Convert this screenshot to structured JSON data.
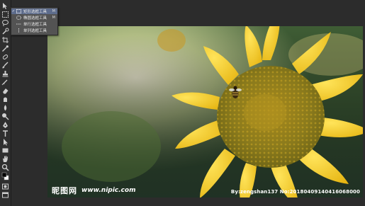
{
  "tool_flyout": {
    "items": [
      {
        "label": "矩形选框工具",
        "shortcut": "M",
        "selected": true,
        "icon": "rect-marquee-icon"
      },
      {
        "label": "椭圆选框工具",
        "shortcut": "M",
        "selected": false,
        "icon": "ellipse-marquee-icon"
      },
      {
        "label": "单行选框工具",
        "shortcut": "",
        "selected": false,
        "icon": "single-row-marquee-icon"
      },
      {
        "label": "单列选框工具",
        "shortcut": "",
        "selected": false,
        "icon": "single-column-marquee-icon"
      }
    ],
    "check_mark": "✓"
  },
  "toolbar": {
    "tools": [
      "move-tool-icon",
      "marquee-tool-icon",
      "lasso-tool-icon",
      "quick-select-icon",
      "crop-tool-icon",
      "eyedropper-icon",
      "spot-healing-icon",
      "brush-tool-icon",
      "clone-stamp-icon",
      "history-brush-icon",
      "eraser-icon",
      "gradient-tool-icon",
      "blur-tool-icon",
      "dodge-tool-icon",
      "pen-tool-icon",
      "type-tool-icon",
      "path-select-icon",
      "rectangle-shape-icon",
      "hand-tool-icon",
      "zoom-tool-icon",
      "color-swatches-icon",
      "quick-mask-icon",
      "screen-mode-icon"
    ],
    "foreground_color": "#000000",
    "background_color": "#ffffff"
  },
  "canvas": {
    "image": "sunflower-with-bee-photo",
    "watermark": {
      "logo": "昵图网",
      "site": "www.nipic.com",
      "id_text": "By:zengshan137 No:20180409140416068000"
    }
  },
  "colors": {
    "workspace": "#2c2c2c",
    "toolbar": "#2f2f2f",
    "flyout": "#535353",
    "flyout_selected": "#5d6c8c"
  }
}
